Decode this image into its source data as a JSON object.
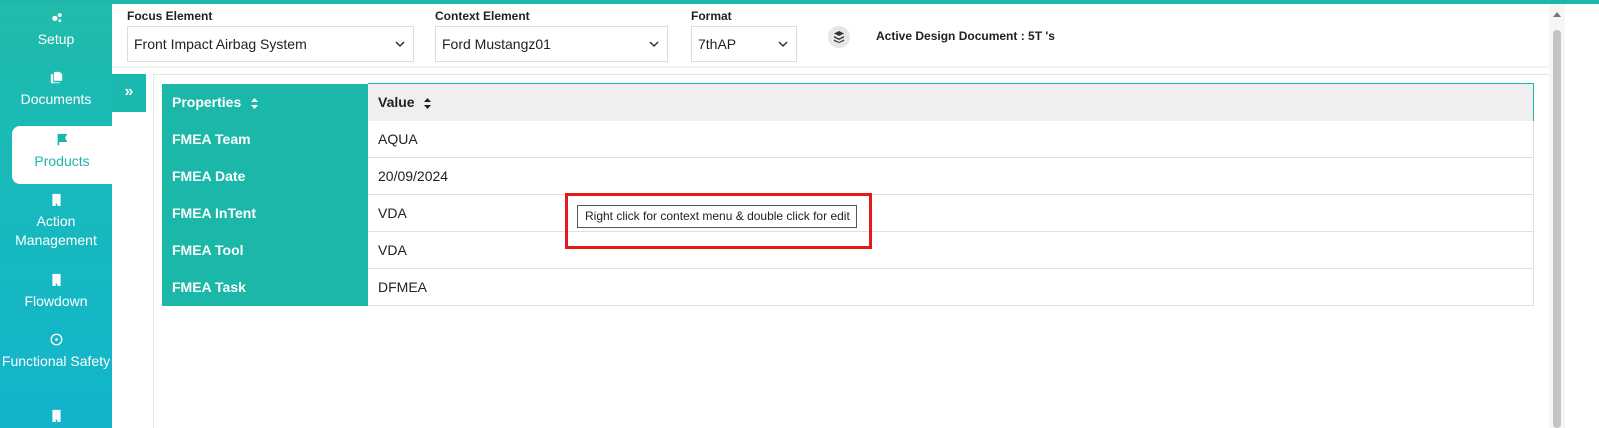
{
  "sidebar": {
    "items": [
      {
        "label": "Setup",
        "icon": "gears-icon"
      },
      {
        "label": "Documents",
        "icon": "copy-icon"
      },
      {
        "label": "Products",
        "icon": "flag-icon"
      },
      {
        "label": "Action Management",
        "icon": "building-icon"
      },
      {
        "label": "Flowdown",
        "icon": "building-icon"
      },
      {
        "label": "Functional Safety",
        "icon": "radiation-icon"
      }
    ]
  },
  "header": {
    "focus": {
      "label": "Focus Element",
      "value": "Front Impact Airbag System"
    },
    "context": {
      "label": "Context Element",
      "value": "Ford Mustangz01"
    },
    "format": {
      "label": "Format",
      "value": "7thAP"
    },
    "active_doc": "Active Design Document : 5T 's"
  },
  "toggle_label": "»",
  "table": {
    "columns": [
      "Properties",
      "Value"
    ],
    "rows": [
      {
        "property": "FMEA Team",
        "value": "AQUA"
      },
      {
        "property": "FMEA Date",
        "value": "20/09/2024"
      },
      {
        "property": "FMEA InTent",
        "value": "VDA"
      },
      {
        "property": "FMEA Tool",
        "value": "VDA"
      },
      {
        "property": "FMEA Task",
        "value": "DFMEA"
      }
    ]
  },
  "tooltip": "Right click for context menu & double click for edit",
  "colors": {
    "accent": "#1bb8aa",
    "highlight": "#e41a1a"
  }
}
